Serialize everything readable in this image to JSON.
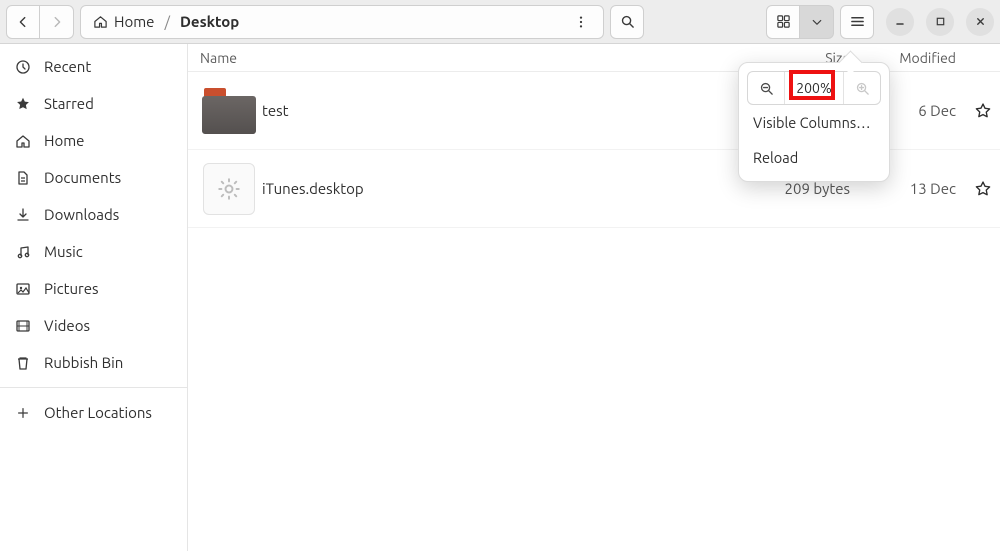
{
  "breadcrumb": {
    "root": "Home",
    "current": "Desktop",
    "sep": "/"
  },
  "columns": {
    "name": "Name",
    "size": "Size",
    "modified": "Modified"
  },
  "sidebar": {
    "items": [
      {
        "label": "Recent"
      },
      {
        "label": "Starred"
      },
      {
        "label": "Home"
      },
      {
        "label": "Documents"
      },
      {
        "label": "Downloads"
      },
      {
        "label": "Music"
      },
      {
        "label": "Pictures"
      },
      {
        "label": "Videos"
      },
      {
        "label": "Rubbish Bin"
      }
    ],
    "other": "Other Locations"
  },
  "files": [
    {
      "name": "test",
      "size": "",
      "modified": "6 Dec"
    },
    {
      "name": "iTunes.desktop",
      "size": "209 bytes",
      "modified": "13 Dec"
    }
  ],
  "popover": {
    "zoom": "200%",
    "visible_columns": "Visible Columns…",
    "reload": "Reload"
  }
}
